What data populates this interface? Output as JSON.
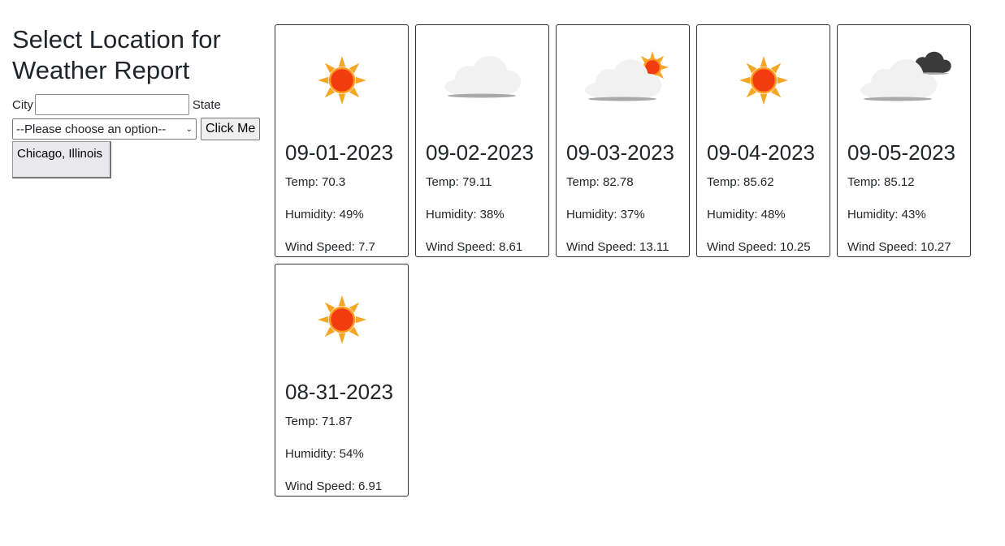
{
  "title": "Select Location for Weather Report",
  "form": {
    "city_label": "City",
    "city_value": "",
    "state_label": "State",
    "state_selected": "--Please choose an option--",
    "submit_label": "Click Me"
  },
  "history": [
    "Chicago, Illinois"
  ],
  "cards": [
    {
      "icon": "sun-icon",
      "date": "09-01-2023",
      "temp": "Temp: 70.3",
      "humidity": "Humidity: 49%",
      "wind": "Wind Speed: 7.7"
    },
    {
      "icon": "cloud-icon",
      "date": "09-02-2023",
      "temp": "Temp: 79.11",
      "humidity": "Humidity: 38%",
      "wind": "Wind Speed: 8.61"
    },
    {
      "icon": "partly-cloudy-icon",
      "date": "09-03-2023",
      "temp": "Temp: 82.78",
      "humidity": "Humidity: 37%",
      "wind": "Wind Speed: 13.11"
    },
    {
      "icon": "sun-icon",
      "date": "09-04-2023",
      "temp": "Temp: 85.62",
      "humidity": "Humidity: 48%",
      "wind": "Wind Speed: 10.25"
    },
    {
      "icon": "dark-clouds-icon",
      "date": "09-05-2023",
      "temp": "Temp: 85.12",
      "humidity": "Humidity: 43%",
      "wind": "Wind Speed: 10.27"
    },
    {
      "icon": "sun-icon",
      "date": "08-31-2023",
      "temp": "Temp: 71.87",
      "humidity": "Humidity: 54%",
      "wind": "Wind Speed: 6.91"
    }
  ]
}
